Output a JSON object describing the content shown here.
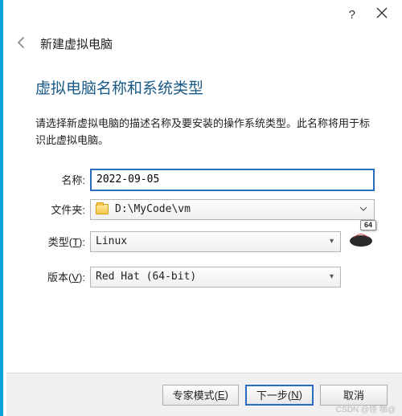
{
  "titlebar": {
    "help": "?",
    "close": "✕"
  },
  "header": {
    "title": "新建虚拟电脑"
  },
  "section": {
    "heading": "虚拟电脑名称和系统类型",
    "instruction": "请选择新虚拟电脑的描述名称及要安装的操作系统类型。此名称将用于标识此虚拟电脑。"
  },
  "form": {
    "name_label": "名称:",
    "name_value": "2022-09-05",
    "folder_label": "文件夹:",
    "folder_value": "D:\\MyCode\\vm",
    "type_label_pre": "类型(",
    "type_hotkey": "T",
    "type_label_post": "):",
    "type_value": "Linux",
    "version_label_pre": "版本(",
    "version_hotkey": "V",
    "version_label_post": "):",
    "version_value": "Red Hat (64-bit)",
    "badge64": "64"
  },
  "buttons": {
    "expert_pre": "专家模式(",
    "expert_hotkey": "E",
    "expert_post": ")",
    "next_pre": "下一步(",
    "next_hotkey": "N",
    "next_post": ")",
    "cancel": "取消"
  },
  "watermark": {
    "w1": "CSDN @怪 咖@"
  }
}
